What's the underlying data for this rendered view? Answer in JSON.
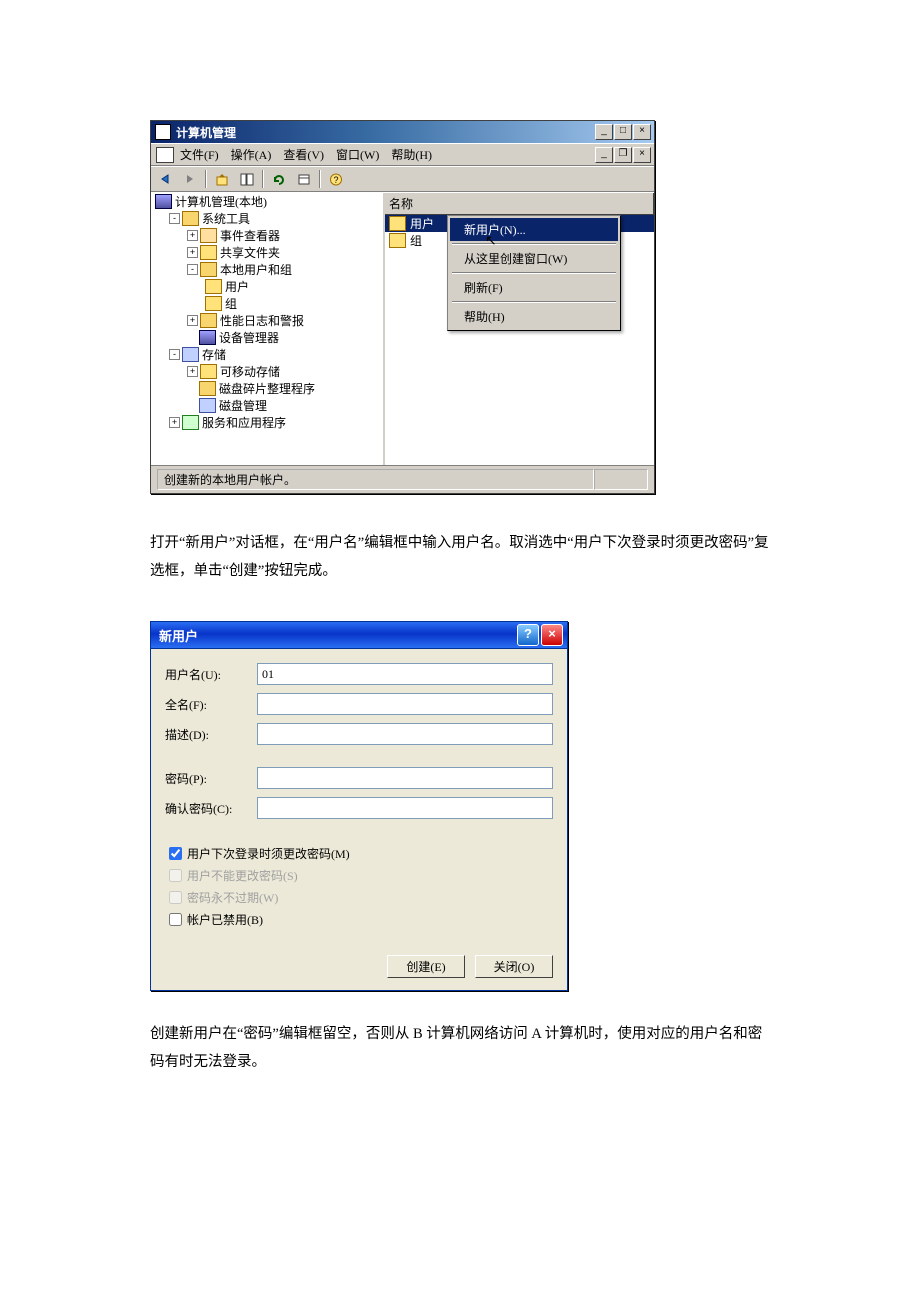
{
  "cm": {
    "title": "计算机管理",
    "menu": {
      "file": "文件(F)",
      "action": "操作(A)",
      "view": "查看(V)",
      "window": "窗口(W)",
      "help": "帮助(H)"
    },
    "tree": {
      "root": "计算机管理(本地)",
      "systools": "系统工具",
      "eventviewer": "事件查看器",
      "sharedfolders": "共享文件夹",
      "localusers": "本地用户和组",
      "users": "用户",
      "groups": "组",
      "perflogs": "性能日志和警报",
      "devmgr": "设备管理器",
      "storage": "存储",
      "removable": "可移动存储",
      "defrag": "磁盘碎片整理程序",
      "diskmgmt": "磁盘管理",
      "services": "服务和应用程序"
    },
    "listheader": "名称",
    "listitems": {
      "users": "用户",
      "groups": "组"
    },
    "context": {
      "newuser": "新用户(N)...",
      "newwin": "从这里创建窗口(W)",
      "refresh": "刷新(F)",
      "help": "帮助(H)"
    },
    "status": "创建新的本地用户帐户。"
  },
  "para1": "打开“新用户”对话框，在“用户名”编辑框中输入用户名。取消选中“用户下次登录时须更改密码”复选框，单击“创建”按钮完成。",
  "dlg": {
    "title": "新用户",
    "labels": {
      "username": "用户名(U):",
      "fullname": "全名(F):",
      "desc": "描述(D):",
      "password": "密码(P):",
      "confirm": "确认密码(C):"
    },
    "values": {
      "username": "01",
      "fullname": "",
      "desc": "",
      "password": "",
      "confirm": ""
    },
    "checks": {
      "mustchange": "用户下次登录时须更改密码(M)",
      "cannotchange": "用户不能更改密码(S)",
      "neverexpire": "密码永不过期(W)",
      "disabled": "帐户已禁用(B)"
    },
    "buttons": {
      "create": "创建(E)",
      "close": "关闭(O)"
    }
  },
  "para2": "创建新用户在“密码”编辑框留空，否则从 B 计算机网络访问 A 计算机时，使用对应的用户名和密码有时无法登录。"
}
